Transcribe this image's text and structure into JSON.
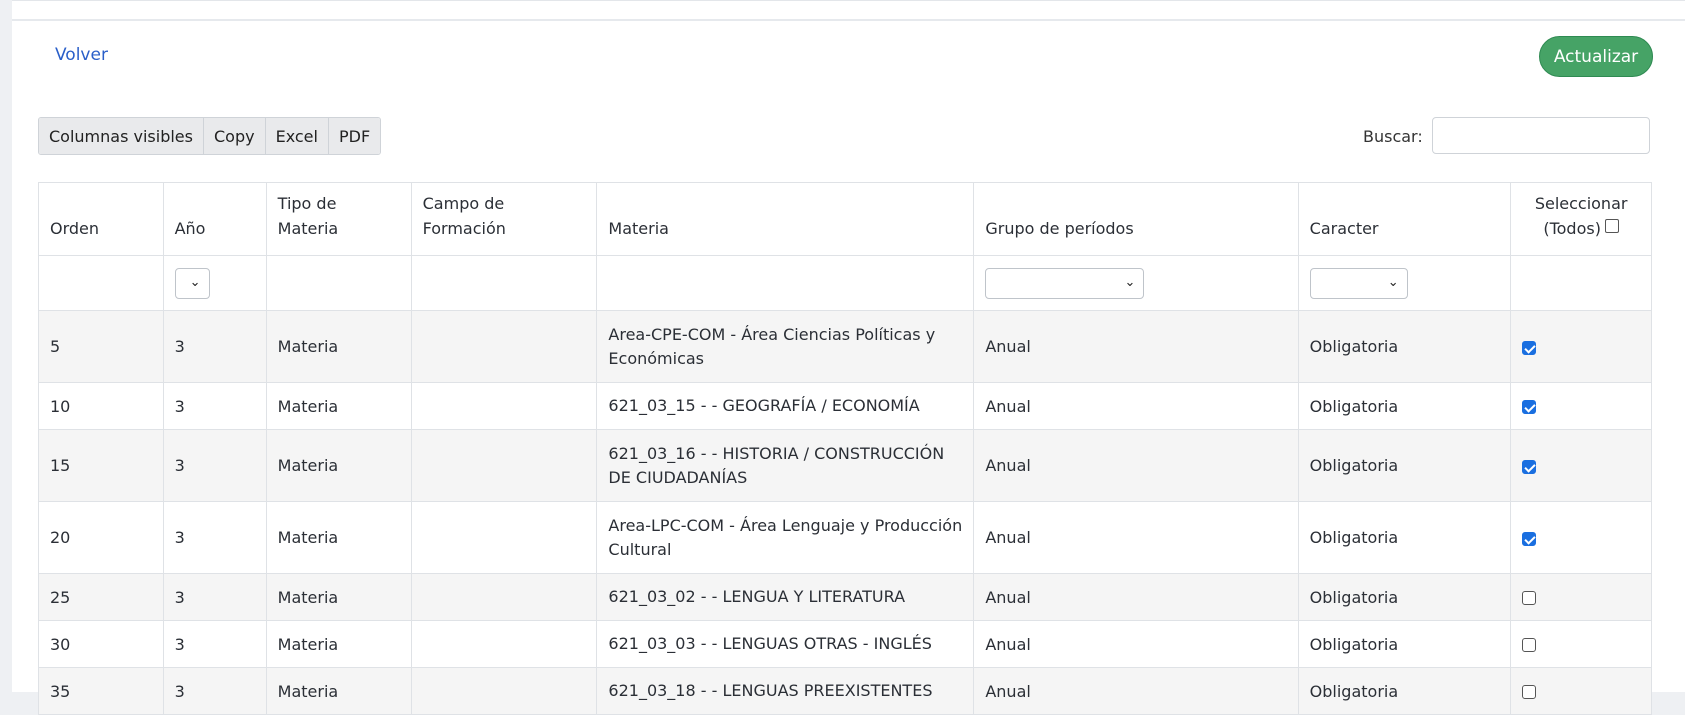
{
  "nav": {
    "back_label": "Volver",
    "update_label": "Actualizar"
  },
  "toolbar": {
    "buttons": [
      "Columnas visibles",
      "Copy",
      "Excel",
      "PDF"
    ],
    "search_label": "Buscar:",
    "search_value": ""
  },
  "table": {
    "columns": [
      "Orden",
      "Año",
      "Tipo de Materia",
      "Campo de Formación",
      "Materia",
      "Grupo de períodos",
      "Caracter",
      "Seleccionar (Todos)"
    ],
    "filters": {
      "anio": "",
      "grupo_periodos": "",
      "caracter": ""
    },
    "select_all_checked": false,
    "rows": [
      {
        "orden": "5",
        "anio": "3",
        "tipo": "Materia",
        "campo": "",
        "materia": "Area-CPE-COM - Área Ciencias Políticas y Económicas",
        "grupo": "Anual",
        "caracter": "Obligatoria",
        "selected": true
      },
      {
        "orden": "10",
        "anio": "3",
        "tipo": "Materia",
        "campo": "",
        "materia": "621_03_15 - - GEOGRAFÍA / ECONOMÍA",
        "grupo": "Anual",
        "caracter": "Obligatoria",
        "selected": true
      },
      {
        "orden": "15",
        "anio": "3",
        "tipo": "Materia",
        "campo": "",
        "materia": "621_03_16 - - HISTORIA / CONSTRUCCIÓN DE CIUDADANÍAS",
        "grupo": "Anual",
        "caracter": "Obligatoria",
        "selected": true
      },
      {
        "orden": "20",
        "anio": "3",
        "tipo": "Materia",
        "campo": "",
        "materia": "Area-LPC-COM - Área Lenguaje y Producción Cultural",
        "grupo": "Anual",
        "caracter": "Obligatoria",
        "selected": true
      },
      {
        "orden": "25",
        "anio": "3",
        "tipo": "Materia",
        "campo": "",
        "materia": "621_03_02 - - LENGUA Y LITERATURA",
        "grupo": "Anual",
        "caracter": "Obligatoria",
        "selected": false
      },
      {
        "orden": "30",
        "anio": "3",
        "tipo": "Materia",
        "campo": "",
        "materia": "621_03_03 - - LENGUAS OTRAS - INGLÉS",
        "grupo": "Anual",
        "caracter": "Obligatoria",
        "selected": false
      },
      {
        "orden": "35",
        "anio": "3",
        "tipo": "Materia",
        "campo": "",
        "materia": "621_03_18 - - LENGUAS PREEXISTENTES",
        "grupo": "Anual",
        "caracter": "Obligatoria",
        "selected": false
      }
    ]
  },
  "icons": {
    "dropdown": "chevron-down-icon",
    "checkbox": "checkbox-icon"
  },
  "colors": {
    "accent": "#46a366",
    "link": "#2a5fc9",
    "checked": "#1a6fe0"
  }
}
